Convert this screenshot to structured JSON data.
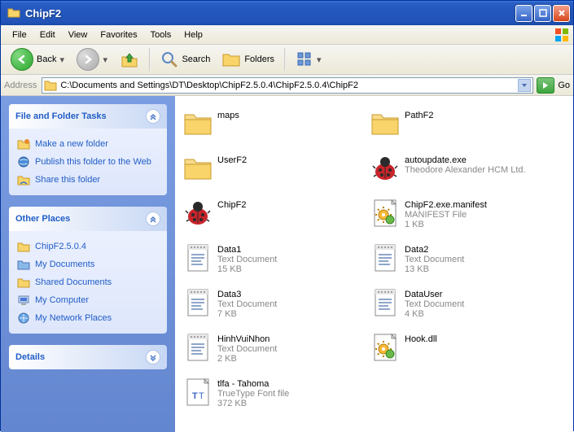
{
  "window": {
    "title": "ChipF2"
  },
  "menu": {
    "file": "File",
    "edit": "Edit",
    "view": "View",
    "favorites": "Favorites",
    "tools": "Tools",
    "help": "Help"
  },
  "toolbar": {
    "back": "Back",
    "search": "Search",
    "folders": "Folders"
  },
  "address": {
    "label": "Address",
    "path": "C:\\Documents and Settings\\DT\\Desktop\\ChipF2.5.0.4\\ChipF2.5.0.4\\ChipF2",
    "go": "Go"
  },
  "sidebar": {
    "tasks": {
      "title": "File and Folder Tasks",
      "items": [
        {
          "label": "Make a new folder"
        },
        {
          "label": "Publish this folder to the Web"
        },
        {
          "label": "Share this folder"
        }
      ]
    },
    "other": {
      "title": "Other Places",
      "items": [
        {
          "label": "ChipF2.5.0.4"
        },
        {
          "label": "My Documents"
        },
        {
          "label": "Shared Documents"
        },
        {
          "label": "My Computer"
        },
        {
          "label": "My Network Places"
        }
      ]
    },
    "details": {
      "title": "Details"
    }
  },
  "files": [
    {
      "name": "maps",
      "type": "folder"
    },
    {
      "name": "PathF2",
      "type": "folder"
    },
    {
      "name": "UserF2",
      "type": "folder"
    },
    {
      "name": "autoupdate.exe",
      "meta1": "Theodore Alexander HCM Ltd.",
      "type": "bug"
    },
    {
      "name": "ChipF2",
      "type": "bug"
    },
    {
      "name": "ChipF2.exe.manifest",
      "meta1": "MANIFEST File",
      "meta2": "1 KB",
      "type": "gear"
    },
    {
      "name": "Data1",
      "meta1": "Text Document",
      "meta2": "15 KB",
      "type": "text"
    },
    {
      "name": "Data2",
      "meta1": "Text Document",
      "meta2": "13 KB",
      "type": "text"
    },
    {
      "name": "Data3",
      "meta1": "Text Document",
      "meta2": "7 KB",
      "type": "text"
    },
    {
      "name": "DataUser",
      "meta1": "Text Document",
      "meta2": "4 KB",
      "type": "text"
    },
    {
      "name": "HinhVuiNhon",
      "meta1": "Text Document",
      "meta2": "2 KB",
      "type": "text"
    },
    {
      "name": "Hook.dll",
      "type": "gear"
    },
    {
      "name": "tlfa - Tahoma",
      "meta1": "TrueType Font file",
      "meta2": "372 KB",
      "type": "font"
    }
  ]
}
